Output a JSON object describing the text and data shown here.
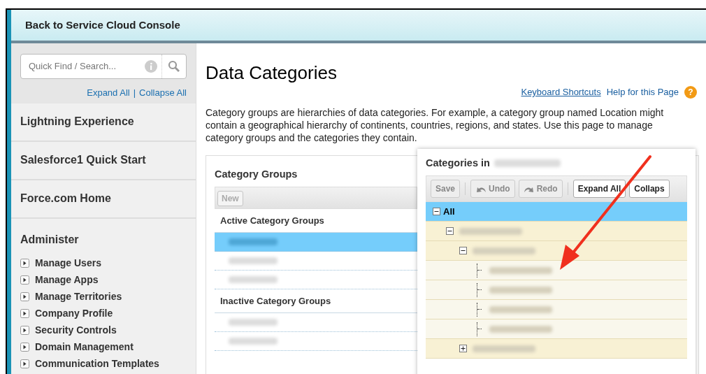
{
  "header": {
    "title": "Back to Service Cloud Console"
  },
  "sidebar": {
    "search": {
      "placeholder": "Quick Find / Search..."
    },
    "expand_all": "Expand All",
    "separator": "|",
    "collapse_all": "Collapse All",
    "sections": [
      {
        "title": "Lightning Experience"
      },
      {
        "title": "Salesforce1 Quick Start"
      },
      {
        "title": "Force.com Home"
      }
    ],
    "administer": {
      "title": "Administer",
      "items": [
        {
          "label": "Manage Users",
          "expanded": false
        },
        {
          "label": "Manage Apps",
          "expanded": false
        },
        {
          "label": "Manage Territories",
          "expanded": false
        },
        {
          "label": "Company Profile",
          "expanded": false
        },
        {
          "label": "Security Controls",
          "expanded": false
        },
        {
          "label": "Domain Management",
          "expanded": false
        },
        {
          "label": "Communication Templates",
          "expanded": false
        }
      ]
    }
  },
  "page": {
    "title": "Data Categories",
    "keyboard_shortcuts": "Keyboard Shortcuts",
    "help": "Help for this Page",
    "help_icon": "?",
    "description": "Category groups are hierarchies of data categories. For example, a category group named Location might contain a geographical hierarchy of continents, countries, regions, and states. Use this page to manage category groups and the categories they contain."
  },
  "category_groups": {
    "title": "Category Groups",
    "new_button": {
      "label": "New",
      "disabled": true
    },
    "sections": [
      {
        "title": "Active Category Groups",
        "items": [
          {
            "selected": true
          },
          {
            "selected": false
          },
          {
            "selected": false
          }
        ]
      },
      {
        "title": "Inactive Category Groups",
        "items": [
          {
            "selected": false
          },
          {
            "selected": false
          }
        ]
      }
    ]
  },
  "categories": {
    "title": "Categories in",
    "toolbar": [
      {
        "label": "Save",
        "kind": "button",
        "disabled": true
      },
      {
        "kind": "separator"
      },
      {
        "label": "Undo",
        "kind": "undo",
        "disabled": true
      },
      {
        "label": "Redo",
        "kind": "redo",
        "disabled": true
      },
      {
        "kind": "separator"
      },
      {
        "label": "Expand All",
        "kind": "button",
        "disabled": false
      },
      {
        "label": "Collaps",
        "kind": "button",
        "disabled": false
      }
    ],
    "tree": [
      {
        "label": "All",
        "selected": true,
        "expanded": true,
        "children": [
          {
            "selected": false,
            "expanded": true,
            "children": [
              {
                "selected": false,
                "expanded": true,
                "children": [
                  {
                    "selected": false
                  },
                  {
                    "selected": false
                  },
                  {
                    "selected": false
                  },
                  {
                    "selected": false
                  }
                ]
              },
              {
                "selected": false,
                "expanded": false
              }
            ]
          }
        ]
      }
    ]
  }
}
